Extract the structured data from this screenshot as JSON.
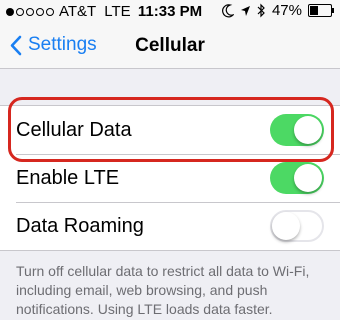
{
  "status_bar": {
    "carrier": "AT&T",
    "network": "LTE",
    "time": "11:33 PM",
    "battery": "47%",
    "battery_level": 0.47,
    "signal_bars_filled": 1,
    "icons": [
      "moon-icon",
      "location-icon",
      "bluetooth-icon"
    ]
  },
  "nav": {
    "back_label": "Settings",
    "title": "Cellular"
  },
  "rows": [
    {
      "label": "Cellular Data",
      "state": "on"
    },
    {
      "label": "Enable LTE",
      "state": "on"
    },
    {
      "label": "Data Roaming",
      "state": "off"
    }
  ],
  "footer": "Turn off cellular data to restrict all data to Wi-Fi, including email, web browsing, and push notifications. Using LTE loads data faster.",
  "colors": {
    "toggle_on": "#4cd964",
    "accent": "#1a7ff2",
    "highlight_annotation": "#d6271f"
  }
}
